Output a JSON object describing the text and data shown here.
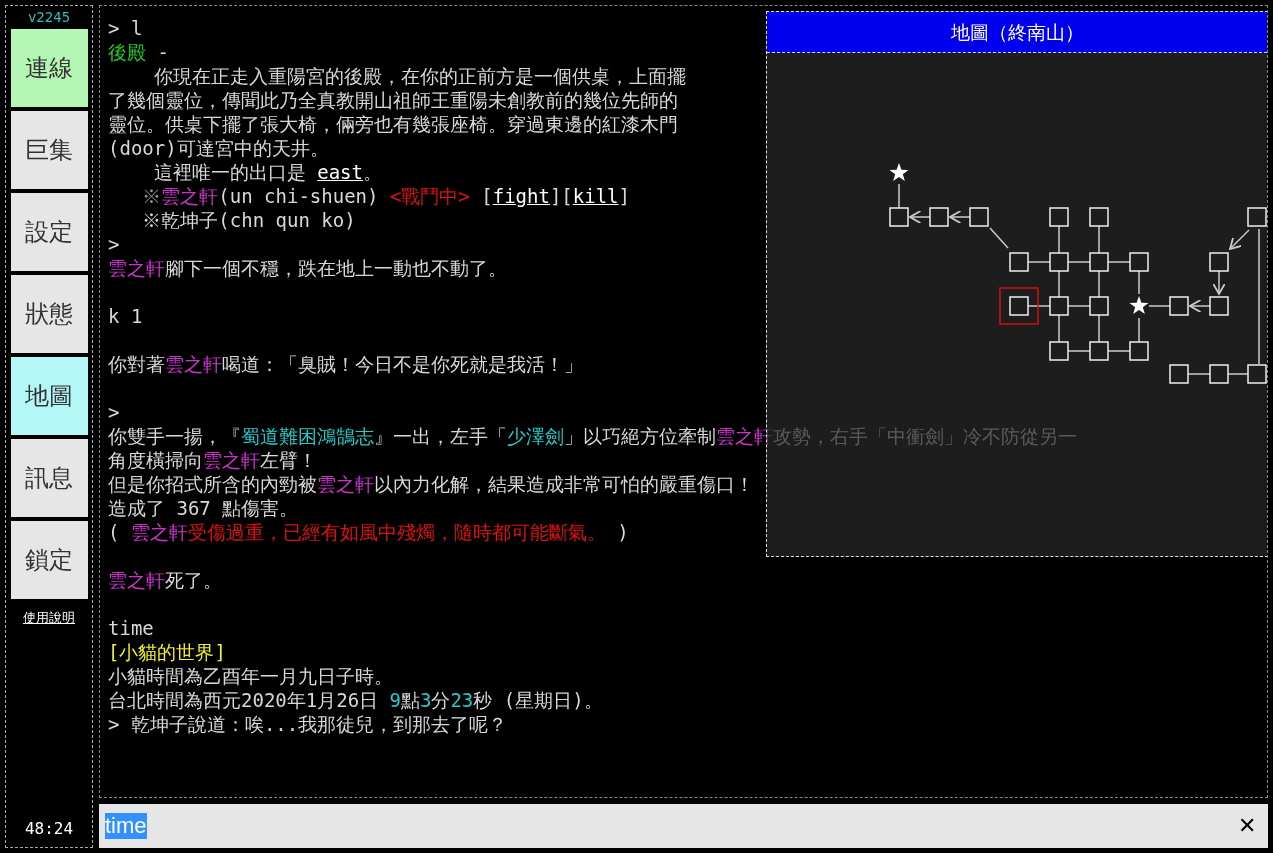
{
  "sidebar": {
    "version": "v2245",
    "buttons": [
      {
        "label": "連線",
        "color": "#b4f7b4"
      },
      {
        "label": "巨集",
        "color": "#e6e6e6"
      },
      {
        "label": "設定",
        "color": "#e6e6e6"
      },
      {
        "label": "狀態",
        "color": "#e6e6e6"
      },
      {
        "label": "地圖",
        "color": "#b4f7f7"
      },
      {
        "label": "訊息",
        "color": "#e6e6e6"
      },
      {
        "label": "鎖定",
        "color": "#e6e6e6"
      }
    ],
    "help_link": "使用說明",
    "clock": "48:24"
  },
  "terminal": {
    "blocks": [
      [
        [
          {
            "kind": "plain",
            "text": "> l"
          }
        ],
        [
          {
            "kind": "room",
            "text": "後殿"
          },
          {
            "kind": "plain",
            "text": " -"
          }
        ],
        [
          {
            "kind": "plain",
            "text": "    你現在正走入重陽宮的後殿，在你的正前方是一個供桌，上面擺"
          }
        ],
        [
          {
            "kind": "plain",
            "text": "了幾個靈位，傳聞此乃全真教開山祖師王重陽未創教前的幾位先師的"
          }
        ],
        [
          {
            "kind": "plain",
            "text": "靈位。供桌下擺了張大椅，倆旁也有幾張座椅。穿過東邊的紅漆木門"
          }
        ],
        [
          {
            "kind": "plain",
            "text": "(door)可達宮中的天井。"
          }
        ],
        [
          {
            "kind": "plain",
            "text": "    這裡唯一的出口是 "
          },
          {
            "kind": "link",
            "text": "east"
          },
          {
            "kind": "plain",
            "text": "。"
          }
        ],
        [
          {
            "kind": "dim",
            "text": "   ※"
          },
          {
            "kind": "npc",
            "text": "雲之軒"
          },
          {
            "kind": "plain",
            "text": "(un chi-shuen) "
          },
          {
            "kind": "alert",
            "text": "<戰鬥中>"
          },
          {
            "kind": "plain",
            "text": " ["
          },
          {
            "kind": "link",
            "text": "fight"
          },
          {
            "kind": "plain",
            "text": "]["
          },
          {
            "kind": "link",
            "text": "kill"
          },
          {
            "kind": "plain",
            "text": "]"
          }
        ],
        [
          {
            "kind": "plain",
            "text": "   ※乾坤子(chn qun ko)"
          }
        ],
        [
          {
            "kind": "plain",
            "text": ">"
          }
        ],
        [
          {
            "kind": "npc",
            "text": "雲之軒"
          },
          {
            "kind": "plain",
            "text": "腳下一個不穩，跌在地上一動也不動了。"
          }
        ]
      ],
      [
        [
          {
            "kind": "plain",
            "text": "k 1"
          }
        ]
      ],
      [
        [
          {
            "kind": "plain",
            "text": "你對著"
          },
          {
            "kind": "npc",
            "text": "雲之軒"
          },
          {
            "kind": "plain",
            "text": "喝道：「臭賊！今日不是你死就是我活！」"
          }
        ]
      ],
      [
        [
          {
            "kind": "plain",
            "text": ">"
          }
        ],
        [
          {
            "kind": "plain",
            "text": "你雙手一揚，『"
          },
          {
            "kind": "skill",
            "text": "蜀道難困鴻鵠志"
          },
          {
            "kind": "plain",
            "text": "』一出，左手「"
          },
          {
            "kind": "skill",
            "text": "少澤劍"
          },
          {
            "kind": "plain",
            "text": "」以巧絕方位牽制"
          },
          {
            "kind": "npc",
            "text": "雲之軒"
          },
          {
            "kind": "plain",
            "text": "攻勢，右手「中衝劍」冷不防從另一"
          }
        ],
        [
          {
            "kind": "plain",
            "text": "角度橫掃向"
          },
          {
            "kind": "npc",
            "text": "雲之軒"
          },
          {
            "kind": "plain",
            "text": "左臂！"
          }
        ],
        [
          {
            "kind": "plain",
            "text": "但是你招式所含的內勁被"
          },
          {
            "kind": "npc",
            "text": "雲之軒"
          },
          {
            "kind": "plain",
            "text": "以內力化解，結果造成非常可怕的嚴重傷口！"
          }
        ],
        [
          {
            "kind": "plain",
            "text": "造成了 367 點傷害。"
          }
        ],
        [
          {
            "kind": "plain",
            "text": "( "
          },
          {
            "kind": "npc",
            "text": "雲之軒"
          },
          {
            "kind": "alert",
            "text": "受傷過重，已經有如風中殘燭，隨時都可能斷氣。"
          },
          {
            "kind": "plain",
            "text": " )"
          }
        ]
      ],
      [
        [
          {
            "kind": "npc",
            "text": "雲之軒"
          },
          {
            "kind": "plain",
            "text": "死了。"
          }
        ]
      ],
      [
        [
          {
            "kind": "plain",
            "text": "time"
          }
        ],
        [
          {
            "kind": "zone",
            "text": "[小貓的世界]"
          }
        ],
        [
          {
            "kind": "plain",
            "text": "小貓時間為乙酉年一月九日子時。"
          }
        ],
        [
          {
            "kind": "plain",
            "text": "台北時間為西元2020年1月26日 "
          },
          {
            "kind": "number",
            "text": "9"
          },
          {
            "kind": "plain",
            "text": "點"
          },
          {
            "kind": "number",
            "text": "3"
          },
          {
            "kind": "plain",
            "text": "分"
          },
          {
            "kind": "number",
            "text": "23"
          },
          {
            "kind": "plain",
            "text": "秒 (星期日)。"
          }
        ],
        [
          {
            "kind": "plain",
            "text": "> 乾坤子說道：唉...我那徒兒，到那去了呢？"
          }
        ]
      ]
    ]
  },
  "map": {
    "title": "地圖（終南山）"
  },
  "input": {
    "value": "time",
    "value_selected": true,
    "clear_icon": "✕"
  }
}
